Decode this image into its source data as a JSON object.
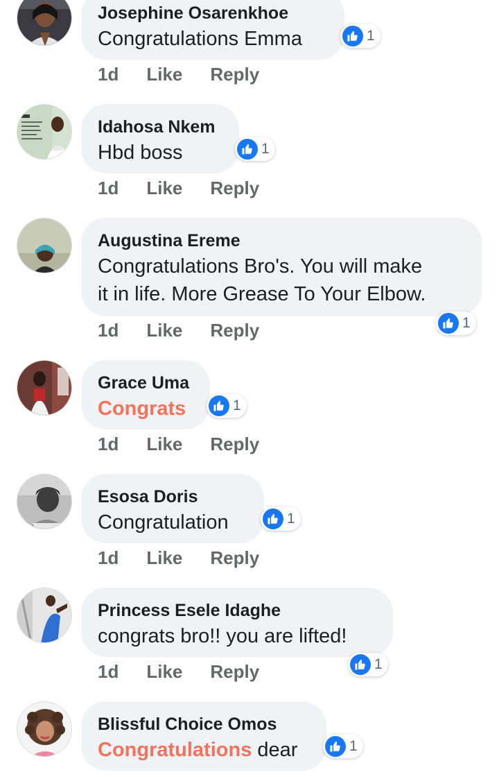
{
  "accent": "#1877f2",
  "highlight_color": "#f0735b",
  "comments": [
    {
      "name": "Josephine Osarenkhoe",
      "text": "Congratulations Emma",
      "time": "1d",
      "like": "Like",
      "reply": "Reply",
      "reaction_icon": "thumbs-up-icon",
      "reaction_count": "1"
    },
    {
      "name": "Idahosa Nkem",
      "text": "Hbd boss",
      "time": "1d",
      "like": "Like",
      "reply": "Reply",
      "reaction_icon": "thumbs-up-icon",
      "reaction_count": "1"
    },
    {
      "name": "Augustina Ereme",
      "text_line1": "Congratulations Bro's. You will make",
      "text_line2": "it in life. More Grease To Your Elbow.",
      "time": "1d",
      "like": "Like",
      "reply": "Reply",
      "reaction_icon": "thumbs-up-icon",
      "reaction_count": "1"
    },
    {
      "name": "Grace Uma",
      "text": "Congrats",
      "time": "1d",
      "like": "Like",
      "reply": "Reply",
      "reaction_icon": "thumbs-up-icon",
      "reaction_count": "1"
    },
    {
      "name": "Esosa Doris",
      "text": "Congratulation",
      "time": "1d",
      "like": "Like",
      "reply": "Reply",
      "reaction_icon": "thumbs-up-icon",
      "reaction_count": "1"
    },
    {
      "name": "Princess Esele Idaghe",
      "text": "congrats bro!! you are lifted!",
      "time": "1d",
      "like": "Like",
      "reply": "Reply",
      "reaction_icon": "thumbs-up-icon",
      "reaction_count": "1"
    },
    {
      "name": "Blissful Choice Omos",
      "text_highlight": "Congratulations",
      "text_rest": " dear",
      "reaction_icon": "thumbs-up-icon",
      "reaction_count": "1"
    }
  ]
}
